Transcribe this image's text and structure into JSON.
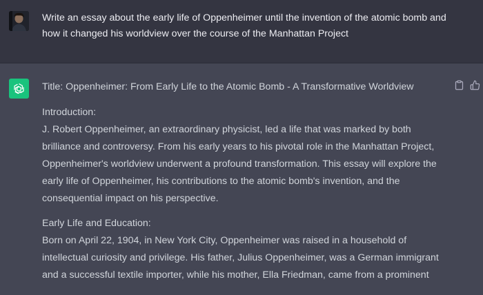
{
  "user_message": {
    "text": "Write an essay about the early life of Oppenheimer until the invention of the atomic bomb and how it changed his worldview over the course of the Manhattan Project"
  },
  "assistant_message": {
    "title": "Title: Oppenheimer: From Early Life to the Atomic Bomb - A Transformative Worldview",
    "intro_heading": "Introduction:",
    "intro_body": "J. Robert Oppenheimer, an extraordinary physicist, led a life that was marked by both brilliance and controversy. From his early years to his pivotal role in the Manhattan Project, Oppenheimer's worldview underwent a profound transformation. This essay will explore the early life of Oppenheimer, his contributions to the atomic bomb's invention, and the consequential impact on his perspective.",
    "early_life_heading": "Early Life and Education:",
    "early_life_body": "Born on April 22, 1904, in New York City, Oppenheimer was raised in a household of intellectual curiosity and privilege. His father, Julius Oppenheimer, was a German immigrant and a successful textile importer, while his mother, Ella Friedman, came from a prominent"
  },
  "icons": {
    "copy": "clipboard-icon",
    "thumbs_up": "thumbs-up-icon",
    "assistant_logo": "openai-logo-icon",
    "user_avatar": "user-avatar"
  },
  "colors": {
    "user_bg": "#343541",
    "assistant_bg": "#444654",
    "assistant_logo_bg": "#19C37D"
  }
}
